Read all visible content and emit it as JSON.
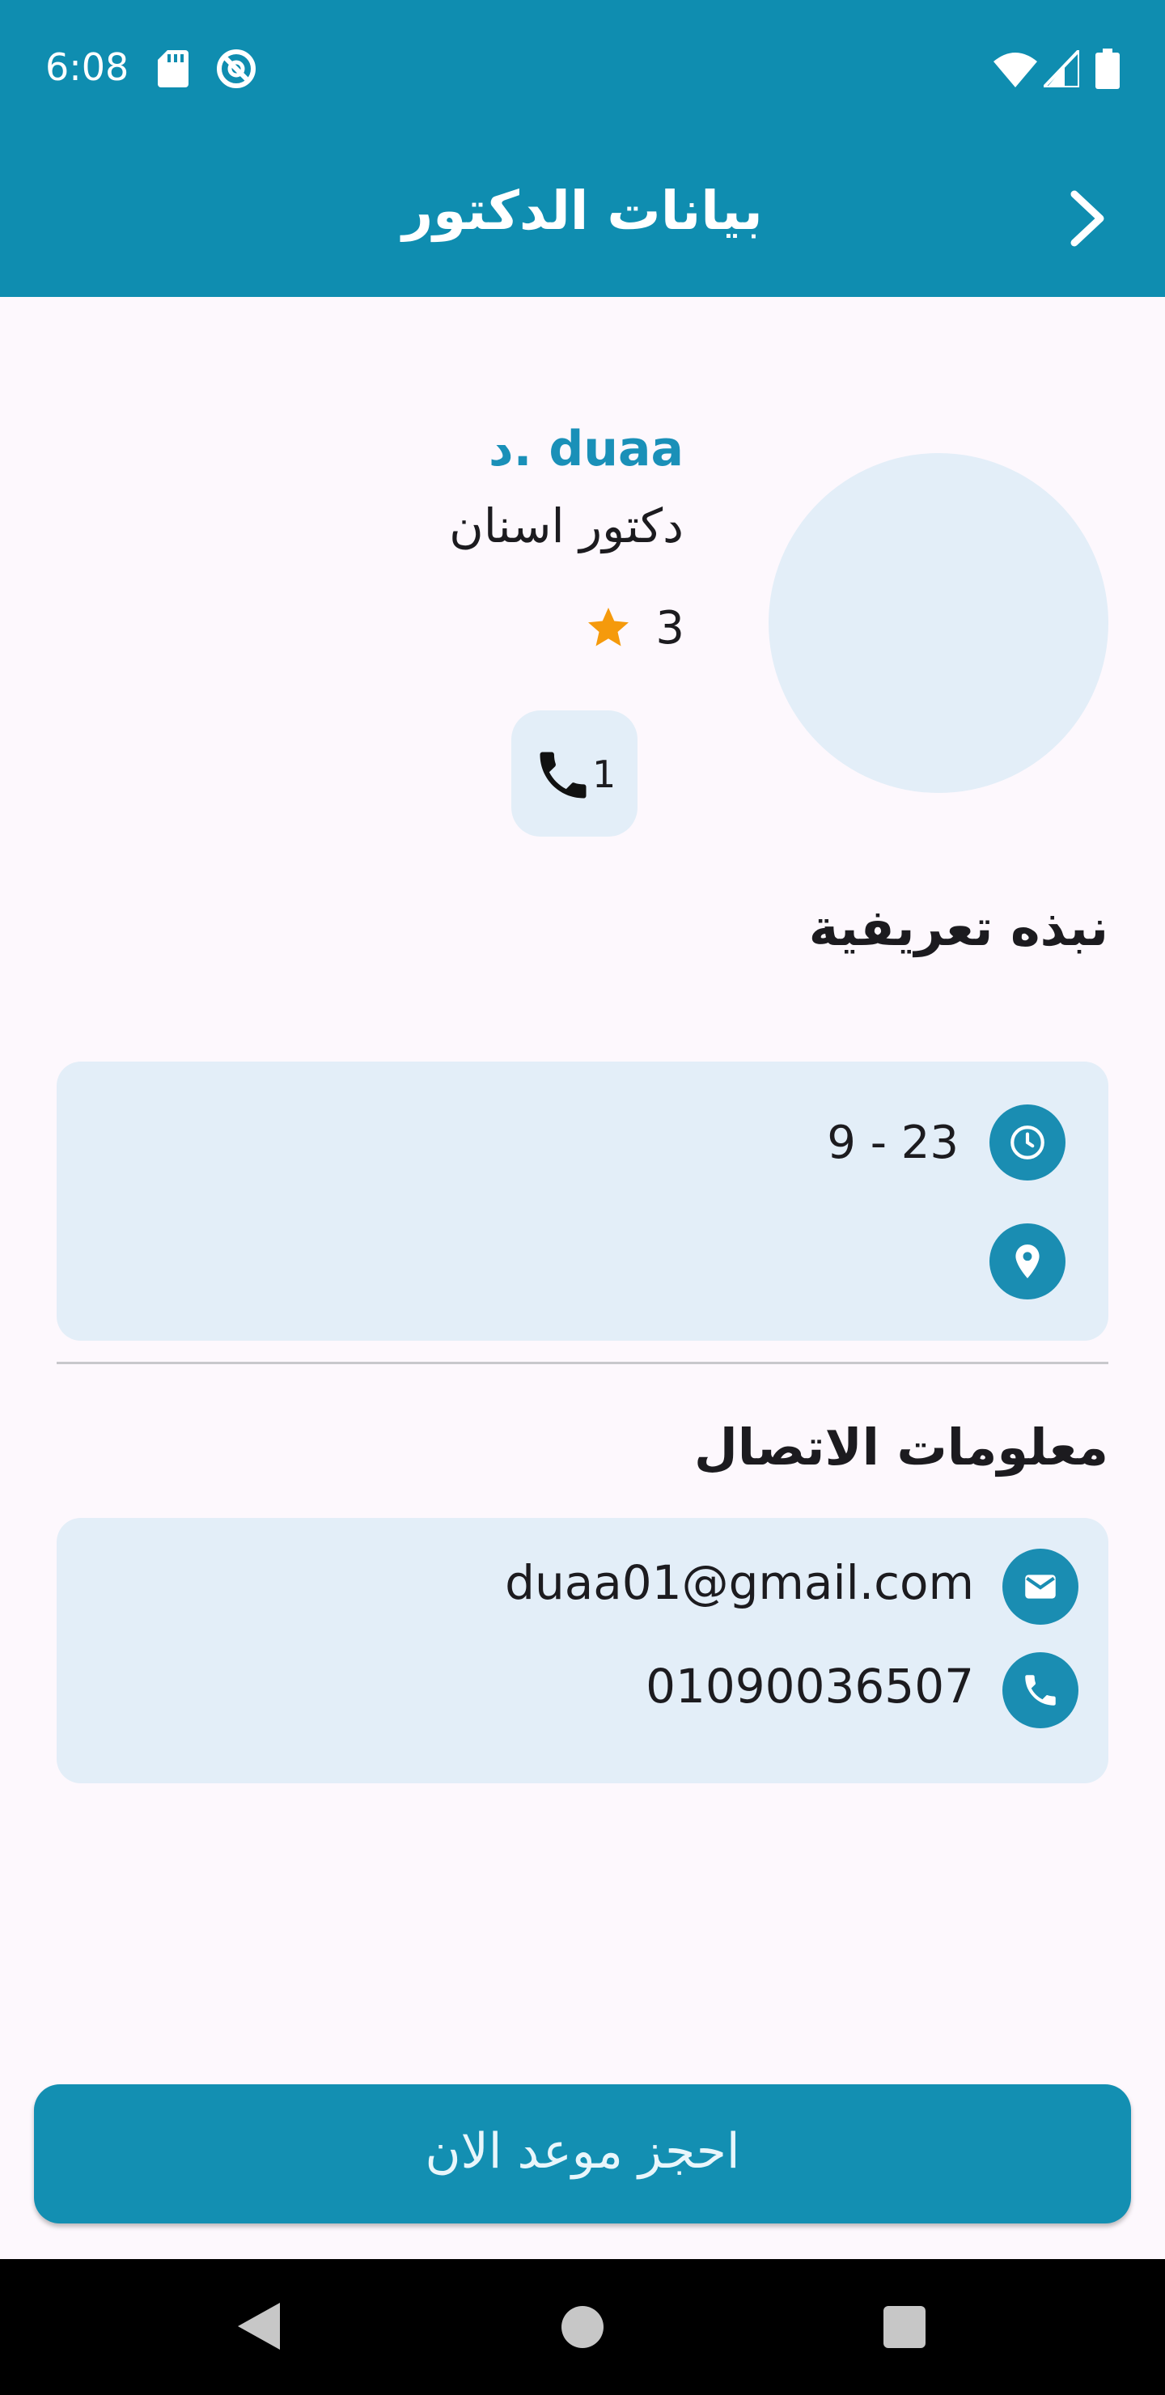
{
  "status_bar": {
    "time": "6:08",
    "icons": [
      "sd-card-icon",
      "sync-icon",
      "wifi-icon",
      "signal-icon",
      "battery-icon"
    ]
  },
  "app_bar": {
    "title": "بيانات الدكتور",
    "back_icon": "chevron-right-icon"
  },
  "doctor": {
    "name": "د. duaa",
    "specialty": "دكتور اسنان",
    "rating": "3",
    "call_count": "1"
  },
  "about": {
    "title": "نبذه تعريفية",
    "hours": "9 - 23",
    "location": ""
  },
  "contact": {
    "title": "معلومات الاتصال",
    "email": "duaa01@gmail.com",
    "phone": "01090036507"
  },
  "actions": {
    "book_label": "احجز موعد الان"
  },
  "colors": {
    "primary": "#0f8db0",
    "card_bg": "#e3eef8",
    "name_accent": "#1a90b8",
    "star": "#f59a0c",
    "page_bg": "#fdf8fd"
  }
}
